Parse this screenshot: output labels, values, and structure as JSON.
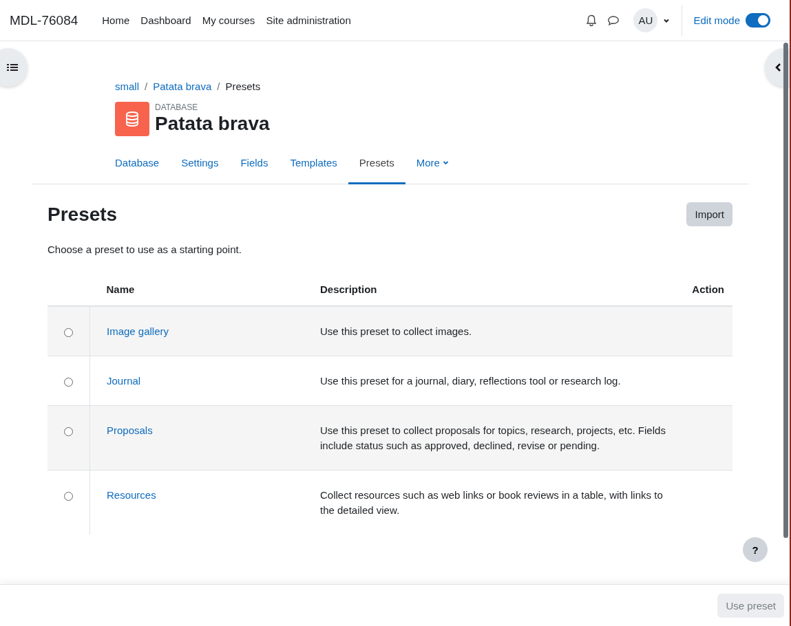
{
  "site_name": "MDL-76084",
  "nav": [
    {
      "label": "Home"
    },
    {
      "label": "Dashboard"
    },
    {
      "label": "My courses"
    },
    {
      "label": "Site administration"
    }
  ],
  "user": {
    "initials": "AU"
  },
  "edit_mode": {
    "label": "Edit mode",
    "on": true
  },
  "breadcrumb_separators": [
    "/",
    "/"
  ],
  "breadcrumb": [
    {
      "label": "small",
      "link": true
    },
    {
      "label": "Patata brava",
      "link": true
    },
    {
      "label": "Presets",
      "link": false
    }
  ],
  "activity": {
    "type": "DATABASE",
    "title": "Patata brava"
  },
  "tabs": [
    {
      "label": "Database",
      "selected": false
    },
    {
      "label": "Settings",
      "selected": false
    },
    {
      "label": "Fields",
      "selected": false
    },
    {
      "label": "Templates",
      "selected": false
    },
    {
      "label": "Presets",
      "selected": true
    },
    {
      "label": "More",
      "selected": false,
      "dropdown": true
    }
  ],
  "heading": "Presets",
  "import_button": "Import",
  "intro": "Choose a preset to use as a starting point.",
  "table": {
    "columns": [
      "Name",
      "Description",
      "Action"
    ],
    "rows": [
      {
        "name": "Image gallery",
        "description": "Use this preset to collect images.",
        "selected": false
      },
      {
        "name": "Journal",
        "description": "Use this preset for a journal, diary, reflections tool or research log.",
        "selected": false
      },
      {
        "name": "Proposals",
        "description": "Use this preset to collect proposals for topics, research, projects, etc. Fields include status such as approved, declined, revise or pending.",
        "selected": false
      },
      {
        "name": "Resources",
        "description": "Collect resources such as web links or book reviews in a table, with links to the detailed view.",
        "selected": false
      }
    ]
  },
  "help_button": "?",
  "footer": {
    "use_preset": {
      "label": "Use preset",
      "disabled": true
    }
  }
}
